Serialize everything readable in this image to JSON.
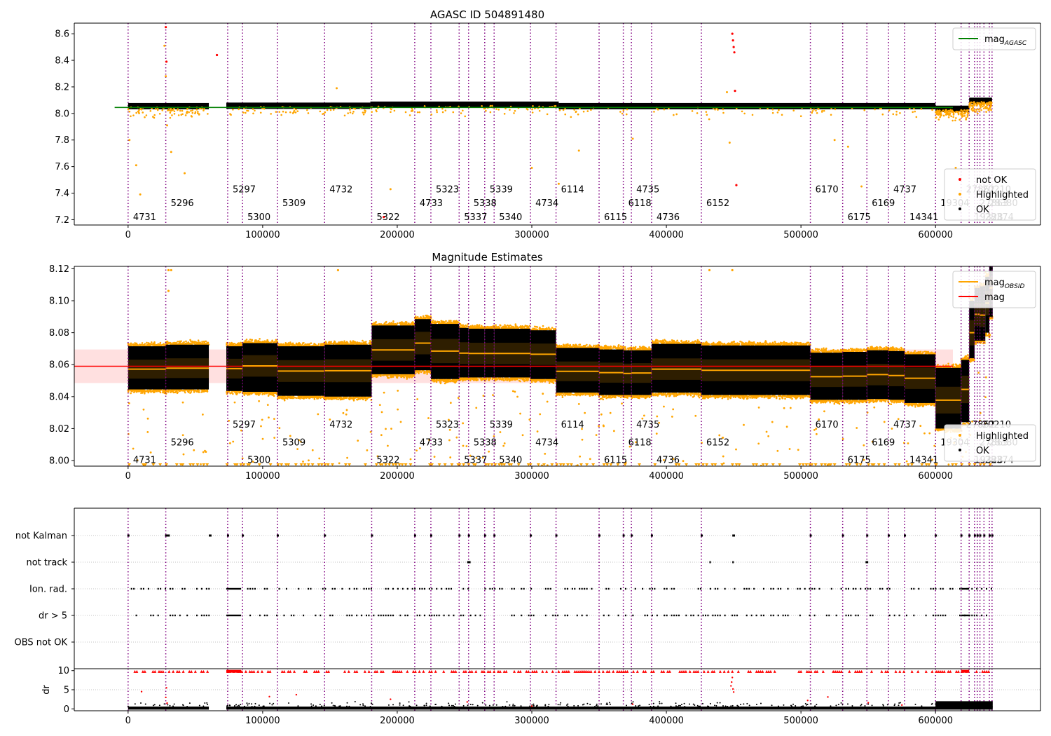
{
  "chart_data": [
    {
      "id": "agasc",
      "type": "scatter",
      "title": "AGASC ID 504891480",
      "xlim": [
        -40000,
        678000
      ],
      "ylim": [
        7.16,
        8.68
      ],
      "xticks": [
        0,
        100000,
        200000,
        300000,
        400000,
        500000,
        600000,
        700000
      ],
      "yticks": [
        7.2,
        7.4,
        7.6,
        7.8,
        8.0,
        8.2,
        8.4,
        8.6
      ],
      "legend_top": {
        "location": "top-right",
        "entries": [
          {
            "label": "mag",
            "sub": "AGASC",
            "color": "#008000",
            "kind": "line"
          }
        ]
      },
      "legend_bottom": {
        "location": "bottom-right",
        "entries": [
          {
            "label": "not OK",
            "color": "#ff0000",
            "kind": "dot"
          },
          {
            "label": "Highlighted",
            "color": "#ffa500",
            "kind": "dot"
          },
          {
            "label": "OK",
            "color": "#000000",
            "kind": "dot"
          }
        ]
      },
      "hline": {
        "y": 8.045,
        "color": "#008000"
      },
      "segments": [
        {
          "x0": 0,
          "x1": 60000,
          "y": 8.055
        },
        {
          "x0": 73000,
          "x1": 180000,
          "y": 8.058
        },
        {
          "x0": 180000,
          "x1": 320000,
          "y": 8.066
        },
        {
          "x0": 320000,
          "x1": 600000,
          "y": 8.055
        },
        {
          "x0": 600000,
          "x1": 625000,
          "y": 8.035
        },
        {
          "x0": 625000,
          "x1": 642000,
          "y": 8.095
        }
      ],
      "obsid_y": [
        7.22,
        7.325,
        7.43
      ],
      "outliers_highlighted": [
        [
          1000,
          7.8
        ],
        [
          6000,
          7.61
        ],
        [
          9000,
          7.39
        ],
        [
          27000,
          8.51
        ],
        [
          28000,
          8.28
        ],
        [
          29000,
          7.91
        ],
        [
          32000,
          7.71
        ],
        [
          42000,
          7.55
        ],
        [
          155000,
          8.19
        ],
        [
          195000,
          7.43
        ],
        [
          300000,
          7.59
        ],
        [
          320000,
          7.47
        ],
        [
          335000,
          7.72
        ],
        [
          375000,
          7.81
        ],
        [
          445000,
          8.16
        ],
        [
          447000,
          7.78
        ],
        [
          525000,
          7.8
        ],
        [
          535000,
          7.75
        ],
        [
          545000,
          7.45
        ],
        [
          615000,
          7.59
        ],
        [
          640000,
          8.07
        ]
      ],
      "outliers_notok": [
        [
          28000,
          8.65
        ],
        [
          28500,
          8.39
        ],
        [
          66000,
          8.44
        ],
        [
          190000,
          7.22
        ],
        [
          449000,
          8.6
        ],
        [
          449500,
          8.55
        ],
        [
          450000,
          8.5
        ],
        [
          450500,
          8.46
        ],
        [
          451000,
          8.17
        ],
        [
          452000,
          7.46
        ]
      ]
    },
    {
      "id": "estimates",
      "type": "scatter",
      "title": "Magnitude Estimates",
      "xlim": [
        -40000,
        678000
      ],
      "ylim": [
        7.9965,
        8.1215
      ],
      "xticks": [
        0,
        100000,
        200000,
        300000,
        400000,
        500000,
        600000,
        700000
      ],
      "yticks": [
        8.0,
        8.02,
        8.04,
        8.06,
        8.08,
        8.1,
        8.12
      ],
      "legend_top": {
        "location": "top-right",
        "entries": [
          {
            "label": "mag",
            "sub": "OBSID",
            "color": "#ffa500",
            "kind": "line"
          },
          {
            "label": "mag",
            "sub": "",
            "color": "#ff0000",
            "kind": "line"
          }
        ]
      },
      "legend_bottom": {
        "location": "bottom-right",
        "entries": [
          {
            "label": "Highlighted",
            "color": "#ffa500",
            "kind": "dot"
          },
          {
            "label": "OK",
            "color": "#000000",
            "kind": "dot"
          }
        ]
      },
      "mag": {
        "y": 8.059,
        "band": [
          8.0485,
          8.0695
        ],
        "color": "#ff0000"
      },
      "obsid_y": [
        8.0005,
        8.0115,
        8.0225
      ],
      "blocks": [
        {
          "x0": 0,
          "x1": 28000,
          "lo": 8.0445,
          "hi": 8.0715,
          "mean": 8.0572
        },
        {
          "x0": 28000,
          "x1": 60000,
          "lo": 8.0445,
          "hi": 8.0725,
          "mean": 8.0578
        },
        {
          "x0": 73000,
          "x1": 85000,
          "lo": 8.0435,
          "hi": 8.0715,
          "mean": 8.0575
        },
        {
          "x0": 85000,
          "x1": 111000,
          "lo": 8.043,
          "hi": 8.0735,
          "mean": 8.0592
        },
        {
          "x0": 111000,
          "x1": 146000,
          "lo": 8.0405,
          "hi": 8.0715,
          "mean": 8.056
        },
        {
          "x0": 146000,
          "x1": 181000,
          "lo": 8.04,
          "hi": 8.0725,
          "mean": 8.0562
        },
        {
          "x0": 181000,
          "x1": 213000,
          "lo": 8.054,
          "hi": 8.0845,
          "mean": 8.0692
        },
        {
          "x0": 213000,
          "x1": 225000,
          "lo": 8.0565,
          "hi": 8.0885,
          "mean": 8.0735
        },
        {
          "x0": 225000,
          "x1": 246000,
          "lo": 8.051,
          "hi": 8.0855,
          "mean": 8.0685
        },
        {
          "x0": 246000,
          "x1": 253000,
          "lo": 8.052,
          "hi": 8.083,
          "mean": 8.0672
        },
        {
          "x0": 253000,
          "x1": 265000,
          "lo": 8.052,
          "hi": 8.0825,
          "mean": 8.067
        },
        {
          "x0": 265000,
          "x1": 272000,
          "lo": 8.052,
          "hi": 8.0825,
          "mean": 8.067
        },
        {
          "x0": 272000,
          "x1": 299000,
          "lo": 8.052,
          "hi": 8.0825,
          "mean": 8.067
        },
        {
          "x0": 299000,
          "x1": 318000,
          "lo": 8.051,
          "hi": 8.0815,
          "mean": 8.0665
        },
        {
          "x0": 318000,
          "x1": 350000,
          "lo": 8.0425,
          "hi": 8.0705,
          "mean": 8.0558
        },
        {
          "x0": 350000,
          "x1": 368000,
          "lo": 8.041,
          "hi": 8.0695,
          "mean": 8.055
        },
        {
          "x0": 368000,
          "x1": 374000,
          "lo": 8.041,
          "hi": 8.069,
          "mean": 8.0545
        },
        {
          "x0": 374000,
          "x1": 389000,
          "lo": 8.041,
          "hi": 8.069,
          "mean": 8.0548
        },
        {
          "x0": 389000,
          "x1": 426000,
          "lo": 8.0425,
          "hi": 8.073,
          "mean": 8.0572
        },
        {
          "x0": 426000,
          "x1": 507000,
          "lo": 8.041,
          "hi": 8.072,
          "mean": 8.0565
        },
        {
          "x0": 507000,
          "x1": 531000,
          "lo": 8.038,
          "hi": 8.0675,
          "mean": 8.0525
        },
        {
          "x0": 531000,
          "x1": 549000,
          "lo": 8.038,
          "hi": 8.068,
          "mean": 8.0528
        },
        {
          "x0": 549000,
          "x1": 565000,
          "lo": 8.0385,
          "hi": 8.069,
          "mean": 8.0538
        },
        {
          "x0": 565000,
          "x1": 577000,
          "lo": 8.038,
          "hi": 8.0685,
          "mean": 8.0532
        },
        {
          "x0": 577000,
          "x1": 600000,
          "lo": 8.036,
          "hi": 8.0665,
          "mean": 8.0515
        },
        {
          "x0": 600000,
          "x1": 619000,
          "lo": 8.02,
          "hi": 8.058,
          "mean": 8.0378
        },
        {
          "x0": 619000,
          "x1": 625000,
          "lo": 8.024,
          "hi": 8.063,
          "mean": 8.0445
        },
        {
          "x0": 625000,
          "x1": 629000,
          "lo": 8.064,
          "hi": 8.1,
          "mean": 8.08
        },
        {
          "x0": 629000,
          "x1": 633000,
          "lo": 8.075,
          "hi": 8.108,
          "mean": 8.0915
        },
        {
          "x0": 633000,
          "x1": 637000,
          "lo": 8.075,
          "hi": 8.109,
          "mean": 8.091
        },
        {
          "x0": 637000,
          "x1": 640000,
          "lo": 8.08,
          "hi": 8.115,
          "mean": 8.0985
        },
        {
          "x0": 640000,
          "x1": 642500,
          "lo": 8.09,
          "hi": 8.122,
          "mean": 8.108
        }
      ]
    },
    {
      "id": "flags",
      "type": "scatter",
      "xlim": [
        -40000,
        678000
      ],
      "categories": [
        "not Kalman",
        "not track",
        "Ion. rad.",
        "dr > 5",
        "OBS not OK"
      ],
      "flag_density": [
        0.01,
        0.005,
        0.3,
        0.3,
        0
      ]
    },
    {
      "id": "dr",
      "type": "scatter",
      "ylabel": "dr",
      "xlim": [
        -40000,
        678000
      ],
      "ylim": [
        -0.5,
        10.5
      ],
      "xticks": [
        0,
        100000,
        200000,
        300000,
        400000,
        500000,
        600000,
        700000
      ],
      "yticks": [
        0,
        5,
        10
      ],
      "clip_points": [
        [
          10000,
          4.5
        ],
        [
          28000,
          3.0
        ],
        [
          28500,
          5.5
        ],
        [
          29000,
          1.5
        ],
        [
          105000,
          3.2
        ],
        [
          125000,
          3.7
        ],
        [
          195000,
          2.5
        ],
        [
          252000,
          1.8
        ],
        [
          300000,
          0.7
        ],
        [
          375000,
          1.2
        ],
        [
          448000,
          6.0
        ],
        [
          448500,
          7.0
        ],
        [
          449000,
          8.2
        ],
        [
          449500,
          5.2
        ],
        [
          450000,
          4.4
        ],
        [
          505000,
          2.2
        ],
        [
          520000,
          3.1
        ],
        [
          550000,
          1.6
        ],
        [
          575000,
          1.0
        ]
      ]
    }
  ],
  "obsids": [
    {
      "x": 0,
      "label": "4731"
    },
    {
      "x": 28000,
      "label": "5296"
    },
    {
      "x": 74000,
      "label": "5297"
    },
    {
      "x": 85000,
      "label": "5300"
    },
    {
      "x": 111000,
      "label": "5309"
    },
    {
      "x": 146000,
      "label": "4732"
    },
    {
      "x": 181000,
      "label": "5322"
    },
    {
      "x": 213000,
      "label": "4733"
    },
    {
      "x": 225000,
      "label": "5323"
    },
    {
      "x": 246000,
      "label": "5337"
    },
    {
      "x": 253000,
      "label": "5338"
    },
    {
      "x": 265000,
      "label": "5339"
    },
    {
      "x": 272000,
      "label": "5340"
    },
    {
      "x": 299000,
      "label": "4734"
    },
    {
      "x": 318000,
      "label": "6114"
    },
    {
      "x": 350000,
      "label": "6115"
    },
    {
      "x": 368000,
      "label": "6118"
    },
    {
      "x": 374000,
      "label": "4735"
    },
    {
      "x": 389000,
      "label": "4736"
    },
    {
      "x": 426000,
      "label": "6152"
    },
    {
      "x": 507000,
      "label": "6170"
    },
    {
      "x": 531000,
      "label": "6175"
    },
    {
      "x": 549000,
      "label": "6169"
    },
    {
      "x": 565000,
      "label": "4737"
    },
    {
      "x": 577000,
      "label": "14341"
    },
    {
      "x": 600000,
      "label": "19304"
    },
    {
      "x": 619000,
      "label": "27862"
    },
    {
      "x": 625000,
      "label": "19328"
    },
    {
      "x": 629000,
      "label": "27863"
    },
    {
      "x": 631000,
      "label": "20210"
    },
    {
      "x": 633000,
      "label": "28374"
    },
    {
      "x": 636000,
      "label": "28380"
    },
    {
      "x": 640000,
      "label": ""
    },
    {
      "x": 642000,
      "label": ""
    }
  ],
  "colors": {
    "obsid_line": "#800080",
    "ok": "#000000",
    "highlighted": "#ffa500",
    "not_ok": "#ff0000",
    "agasc": "#008000"
  }
}
